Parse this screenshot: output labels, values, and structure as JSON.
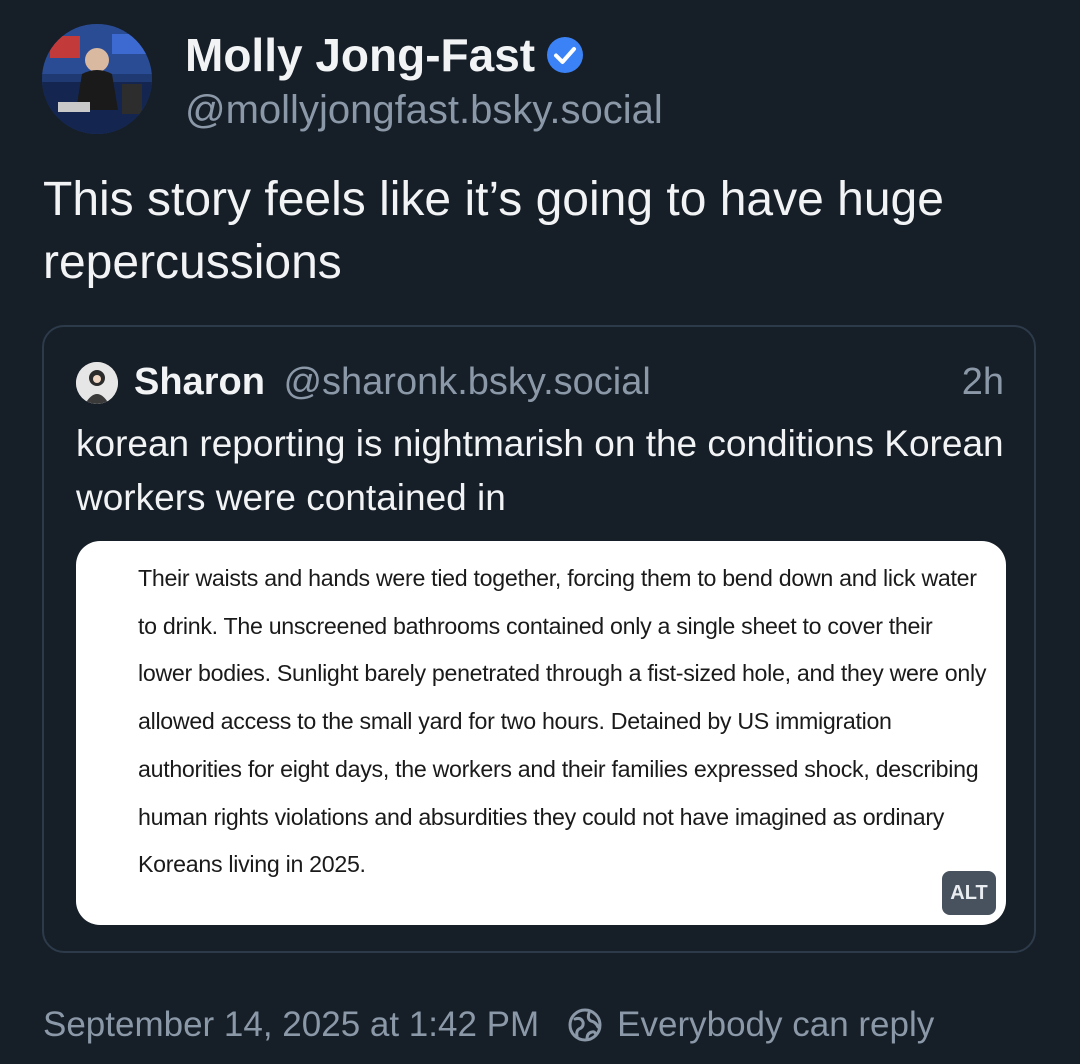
{
  "author": {
    "name": "Molly Jong-Fast",
    "handle": "@mollyjongfast.bsky.social",
    "avatar_icon": "avatar-photo",
    "verified_icon": "verified-badge-icon",
    "verified_color": "#3b82f6"
  },
  "post": {
    "text": "This story feels like it’s going to have huge repercussions"
  },
  "quote": {
    "name": "Sharon",
    "handle": "@sharonk.bsky.social",
    "time": "2h",
    "avatar_icon": "avatar-photo",
    "text": "korean reporting is nightmarish on the conditions Korean workers were contained in",
    "image": {
      "text": "Their waists and hands were tied together, forcing them to bend down and lick water to drink. The unscreened bathrooms contained only a single sheet to cover their lower bodies. Sunlight barely penetrated through a fist-sized hole, and they were only allowed access to the small yard for two hours. Detained by US immigration authorities for eight days, the workers and their families expressed shock, describing human rights violations and absurdities they could not have imagined as ordinary Koreans living in 2025.",
      "alt_badge": "ALT"
    }
  },
  "footer": {
    "timestamp": "September 14, 2025 at 1:42 PM",
    "reply_setting": "Everybody can reply",
    "reply_icon": "globe-icon"
  },
  "colors": {
    "background": "#161e27",
    "text_primary": "#f1f3f5",
    "text_secondary": "#8b98a8",
    "card_border": "#2c3a4a"
  }
}
